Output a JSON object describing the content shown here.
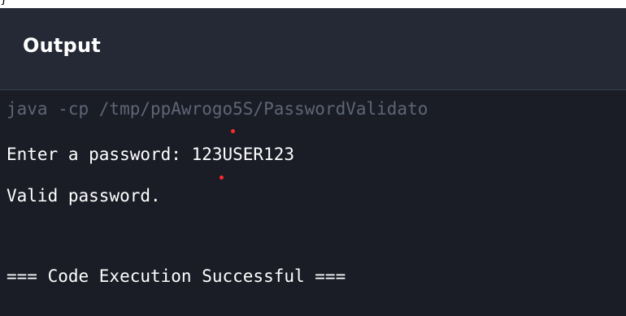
{
  "top_glyph": "}",
  "panel": {
    "title": "Output"
  },
  "console": {
    "command": "java -cp /tmp/ppAwrogo5S/PasswordValidato",
    "lines": [
      "Enter a password: 123USER123",
      "Valid password.",
      "=== Code Execution Successful ==="
    ]
  },
  "colors": {
    "header_bg": "#252936",
    "console_bg": "#1a1d26",
    "command_text": "#5f6576",
    "output_text": "#ffffff",
    "marker": "#ff2a2a"
  },
  "icons": [
    "cursor-marker-dot"
  ]
}
